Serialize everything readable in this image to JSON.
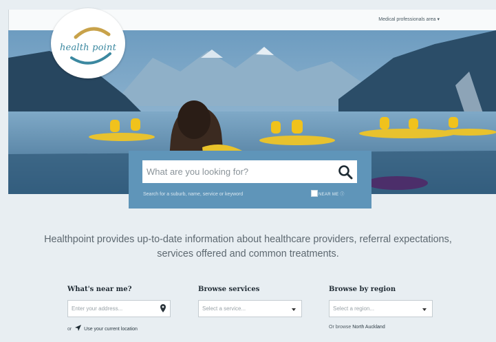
{
  "header": {
    "logo_text": "health point",
    "pro_link": "Medical professionals area ▾"
  },
  "search": {
    "placeholder": "What are you looking for?",
    "hint": "Search for a suburb, name, service or keyword",
    "near_me_label": "NEAR ME ⓘ",
    "icon": "search-icon"
  },
  "intro": {
    "text": "Healthpoint provides up-to-date information about healthcare providers, referral expectations, services offered and common treatments."
  },
  "near_me": {
    "title": "What's near me?",
    "placeholder": "Enter your address...",
    "prefix": "or",
    "location_link": "Use your current location",
    "icon": "location-pin-icon"
  },
  "browse_services": {
    "title": "Browse services",
    "placeholder": "Select a service..."
  },
  "browse_region": {
    "title": "Browse by region",
    "placeholder": "Select a region...",
    "prefix": "Or browse",
    "region_link": "North Auckland"
  },
  "colors": {
    "page_bg": "#e8eef2",
    "search_panel": "#5f95b9",
    "logo_teal": "#3b88a0",
    "logo_gold": "#c8a24a"
  }
}
